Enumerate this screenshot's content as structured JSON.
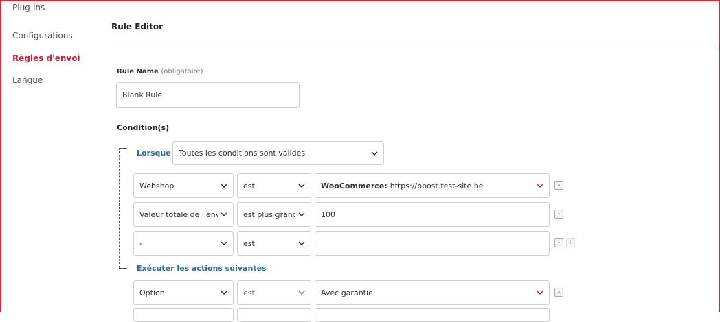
{
  "sidebar": {
    "items": [
      {
        "label": "Plug-ins"
      },
      {
        "label": "Configurations"
      },
      {
        "label": "Règles d'envoi"
      },
      {
        "label": "Langue"
      }
    ]
  },
  "editor": {
    "title": "Rule Editor",
    "rule_name_label": "Rule Name",
    "rule_name_hint": "(obligatoire)",
    "rule_name_value": "Blank Rule",
    "conditions_heading": "Condition(s)",
    "when_label": "Lorsque",
    "when_select": "Toutes les conditions sont valides",
    "conditions": [
      {
        "field": "Webshop",
        "operator": "est",
        "value_strong": "WooCommerce:",
        "value": "https://bpost.test-site.be",
        "remove": "-"
      },
      {
        "field": "Valeur totale de l'envoi",
        "operator": "est plus grand que",
        "value": "100",
        "remove": "-"
      },
      {
        "field": "-",
        "operator": "est",
        "value": "",
        "remove": "-",
        "add": "+"
      }
    ],
    "actions_label": "Exécuter les actions suivantes",
    "actions": [
      {
        "field": "Option",
        "operator": "est",
        "value": "Avec garantie",
        "remove": "-"
      }
    ]
  },
  "colors": {
    "accent": "#d6253a",
    "link": "#2b6ca3"
  }
}
